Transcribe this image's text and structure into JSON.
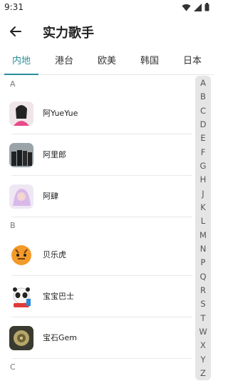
{
  "status": {
    "time": "9:31"
  },
  "header": {
    "title": "实力歌手"
  },
  "tabs": [
    {
      "label": "内地",
      "active": true
    },
    {
      "label": "港台",
      "active": false
    },
    {
      "label": "欧美",
      "active": false
    },
    {
      "label": "韩国",
      "active": false
    },
    {
      "label": "日本",
      "active": false
    }
  ],
  "sections": [
    {
      "letter": "A",
      "artists": [
        "阿YueYue",
        "阿里郎",
        "阿肆"
      ]
    },
    {
      "letter": "B",
      "artists": [
        "贝乐虎",
        "宝宝巴士",
        "宝石Gem"
      ]
    },
    {
      "letter": "C",
      "artists": []
    }
  ],
  "alphabet": [
    "A",
    "B",
    "C",
    "D",
    "E",
    "F",
    "G",
    "H",
    "J",
    "K",
    "L",
    "M",
    "N",
    "P",
    "Q",
    "R",
    "S",
    "T",
    "W",
    "X",
    "Y",
    "Z"
  ],
  "colors": {
    "accent": "#2b8e9b",
    "index_bg": "#e5e5e5"
  }
}
